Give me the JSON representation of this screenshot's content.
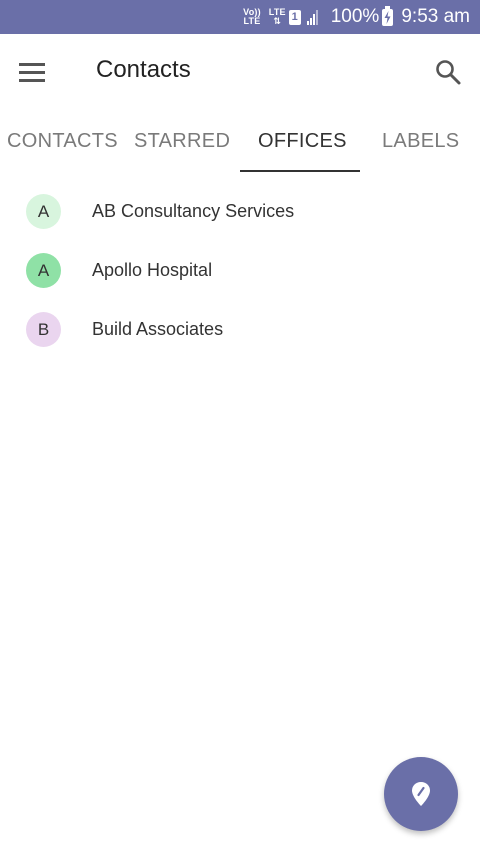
{
  "status_bar": {
    "volte": "Vo))",
    "lte_small": "LTE",
    "lte_top": "LTE",
    "sim_slot": "1",
    "battery_pct": "100%",
    "time": "9:53 am",
    "icons": [
      "volte-icon",
      "data-lte-icon",
      "sim-icon",
      "signal-icon",
      "battery-charging-icon"
    ],
    "bar_color": "#6a6fa8"
  },
  "app_bar": {
    "title": "Contacts",
    "menu_icon": "hamburger-menu-icon",
    "search_icon": "search-icon"
  },
  "tabs": [
    {
      "label": "CONTACTS",
      "active": false
    },
    {
      "label": "STARRED",
      "active": false
    },
    {
      "label": "OFFICES",
      "active": true
    },
    {
      "label": "LABELS",
      "active": false
    }
  ],
  "offices": [
    {
      "initial": "A",
      "name": "AB Consultancy Services",
      "avatar_color": "#d8f5de"
    },
    {
      "initial": "A",
      "name": "Apollo Hospital",
      "avatar_color": "#8fe1a6"
    },
    {
      "initial": "B",
      "name": "Build Associates",
      "avatar_color": "#ead5ef"
    }
  ],
  "fab": {
    "icon": "location-pin-icon",
    "color": "#6a6fa8"
  }
}
